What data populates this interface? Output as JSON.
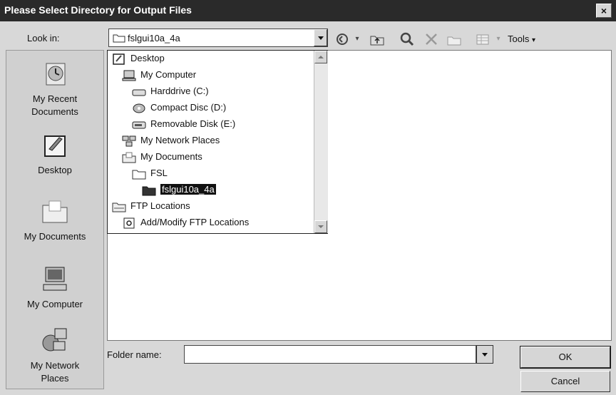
{
  "window": {
    "title": "Please Select Directory for Output Files",
    "close_glyph": "×"
  },
  "toolbar": {
    "look_in_label": "Look in:",
    "look_in_value": "fslgui10a_4a",
    "tools_label": "Tools",
    "icons": [
      "back-icon",
      "up-folder-icon",
      "search-web-icon",
      "delete-icon",
      "new-folder-icon",
      "views-icon"
    ]
  },
  "places": [
    {
      "label_line1": "My Recent",
      "label_line2": "Documents",
      "icon": "recent-documents-icon"
    },
    {
      "label_line1": "Desktop",
      "label_line2": "",
      "icon": "desktop-icon"
    },
    {
      "label_line1": "My Documents",
      "label_line2": "",
      "icon": "my-documents-icon"
    },
    {
      "label_line1": "My Computer",
      "label_line2": "",
      "icon": "my-computer-icon"
    },
    {
      "label_line1": "My Network",
      "label_line2": "Places",
      "icon": "network-places-icon"
    }
  ],
  "dropdown": {
    "items": [
      {
        "label": "Desktop",
        "icon": "desktop-icon"
      },
      {
        "label": "My Computer",
        "icon": "computer-icon"
      },
      {
        "label": "Harddrive (C:)",
        "icon": "hard-drive-icon"
      },
      {
        "label": "Compact Disc (D:)",
        "icon": "cd-drive-icon"
      },
      {
        "label": "Removable Disk (E:)",
        "icon": "removable-disk-icon"
      },
      {
        "label": "My Network Places",
        "icon": "network-icon"
      },
      {
        "label": "My Documents",
        "icon": "documents-icon"
      },
      {
        "label": "FSL",
        "icon": "folder-icon"
      },
      {
        "label": "fslgui10a_4a",
        "icon": "open-folder-icon",
        "selected": true
      },
      {
        "label": "FTP Locations",
        "icon": "ftp-folder-icon"
      },
      {
        "label": "Add/Modify FTP Locations",
        "icon": "ftp-add-icon"
      }
    ]
  },
  "footer": {
    "folder_name_label": "Folder name:",
    "folder_name_value": "",
    "ok_label": "OK",
    "cancel_label": "Cancel"
  }
}
